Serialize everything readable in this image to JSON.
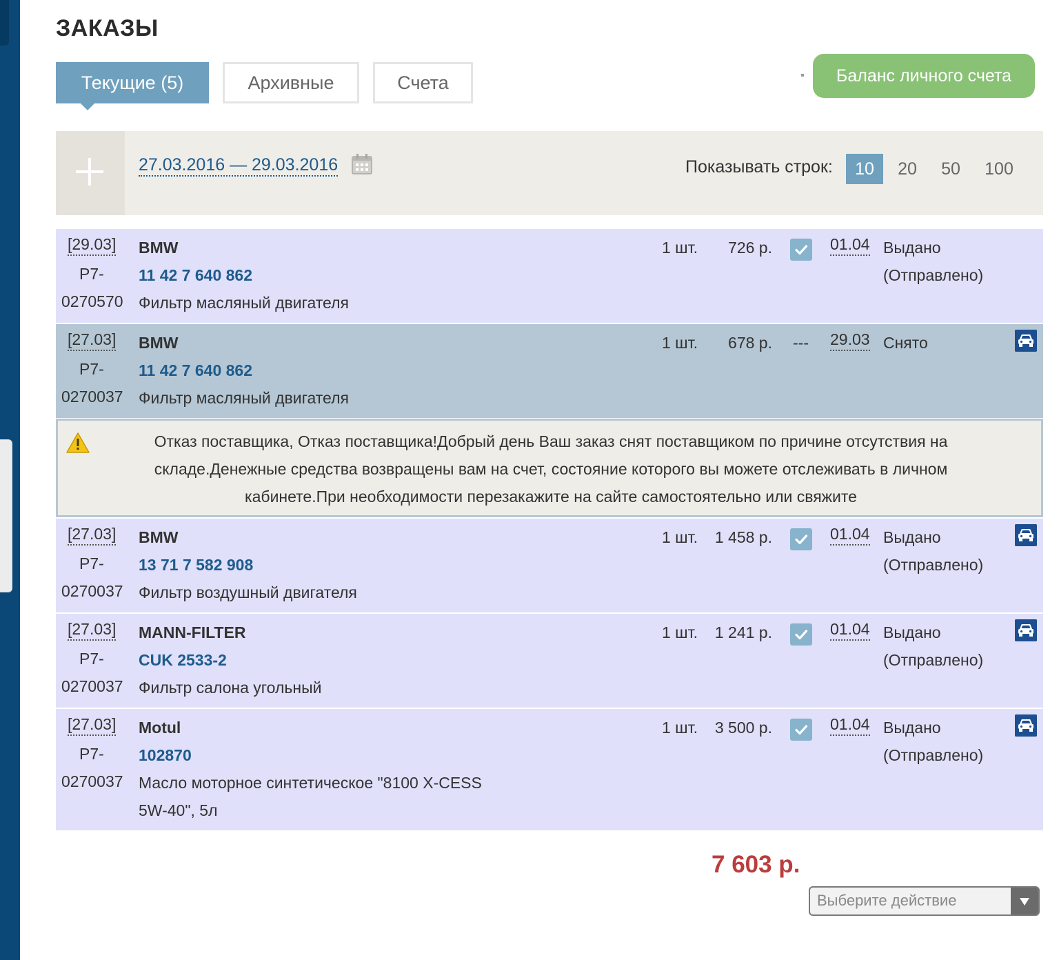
{
  "page": {
    "title": "ЗАКАЗЫ"
  },
  "tabs": [
    {
      "label": "Текущие (5)"
    },
    {
      "label": "Архивные"
    },
    {
      "label": "Счета"
    }
  ],
  "balance_button": "Баланс личного счета",
  "filter": {
    "date_range": "27.03.2016 — 29.03.2016",
    "rows_label": "Показывать строк:",
    "rows_options": [
      "10",
      "20",
      "50",
      "100"
    ],
    "rows_selected": "10"
  },
  "orders": [
    {
      "date": "[29.03]",
      "id_prefix": "Р7-",
      "id_number": "0270570",
      "brand": "BMW",
      "part_number": "11 42 7 640 862",
      "description": "Фильтр масляный двигателя",
      "qty": "1 шт.",
      "price": "726 р.",
      "confirmed": true,
      "delivery_date": "01.04",
      "status": "Выдано",
      "status_note": "(Отправлено)"
    },
    {
      "date": "[27.03]",
      "id_prefix": "Р7-",
      "id_number": "0270037",
      "brand": "BMW",
      "part_number": "11 42 7 640 862",
      "description": "Фильтр масляный двигателя",
      "qty": "1 шт.",
      "price": "678 р.",
      "confirmed": false,
      "confirmed_text": "---",
      "delivery_date": "29.03",
      "status": "Снято",
      "status_note": ""
    },
    {
      "date": "[27.03]",
      "id_prefix": "Р7-",
      "id_number": "0270037",
      "brand": "BMW",
      "part_number": "13 71 7 582 908",
      "description": "Фильтр воздушный двигателя",
      "qty": "1 шт.",
      "price": "1 458 р.",
      "confirmed": true,
      "delivery_date": "01.04",
      "status": "Выдано",
      "status_note": "(Отправлено)"
    },
    {
      "date": "[27.03]",
      "id_prefix": "Р7-",
      "id_number": "0270037",
      "brand": "MANN-FILTER",
      "part_number": "CUK 2533-2",
      "description": "Фильтр салона угольный",
      "qty": "1 шт.",
      "price": "1 241 р.",
      "confirmed": true,
      "delivery_date": "01.04",
      "status": "Выдано",
      "status_note": "(Отправлено)"
    },
    {
      "date": "[27.03]",
      "id_prefix": "Р7-",
      "id_number": "0270037",
      "brand": "Motul",
      "part_number": "102870",
      "description": "Масло моторное синтетическое \"8100 X-CESS 5W-40\", 5л",
      "qty": "1 шт.",
      "price": "3 500 р.",
      "confirmed": true,
      "delivery_date": "01.04",
      "status": "Выдано",
      "status_note": "(Отправлено)"
    }
  ],
  "notice": {
    "icon": "warning-icon",
    "text": "Отказ поставщика, Отказ поставщика!Добрый день Ваш заказ снят поставщиком по причине отсутствия на складе.Денежные средства возвращены вам на счет, состояние которого вы можете отслеживать в личном кабинете.При необходимости перезакажите на сайте самостоятельно или свяжите"
  },
  "total": "7 603 р.",
  "action_select": {
    "placeholder": "Выберите действие"
  },
  "colors": {
    "sidebar": "#0b4877",
    "tab_active": "#6fa0be",
    "balance_button": "#89c275",
    "row_normal": "#e0e0fa",
    "row_cancelled": "#b5c7d4",
    "link": "#1e5b8c",
    "total": "#bb3d3d"
  }
}
